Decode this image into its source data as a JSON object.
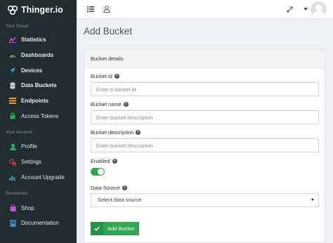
{
  "sidebar": {
    "brand": "Thinger.io",
    "sections": [
      {
        "label": "Your Cloud",
        "items": [
          {
            "label": "Statistics",
            "icon": "chart-icon",
            "color": "#c64fd6"
          },
          {
            "label": "Dashboards",
            "icon": "dashboard-icon",
            "color": "#4caf50"
          },
          {
            "label": "Devices",
            "icon": "rocket-icon",
            "color": "#3c8dbc"
          },
          {
            "label": "Data Buckets",
            "icon": "database-icon",
            "color": "#c7d1d6"
          },
          {
            "label": "Endpoints",
            "icon": "list-icon",
            "color": "#f39c12"
          },
          {
            "label": "Access Tokens",
            "icon": "lock-icon",
            "color": "#27ae60"
          }
        ]
      },
      {
        "label": "Your Account",
        "items": [
          {
            "label": "Profile",
            "icon": "user-icon",
            "color": "#27ae60"
          },
          {
            "label": "Settings",
            "icon": "cogs-icon",
            "color": "#dd4b39"
          },
          {
            "label": "Account Upgrade",
            "icon": "bar-chart-icon",
            "color": "#3c8dbc"
          }
        ]
      },
      {
        "label": "Resources",
        "items": [
          {
            "label": "Shop",
            "icon": "shopping-bag-icon",
            "color": "#c64fd6"
          },
          {
            "label": "Documentation",
            "icon": "book-icon",
            "color": "#3c8dbc"
          }
        ]
      }
    ]
  },
  "page": {
    "title": "Add Bucket"
  },
  "form": {
    "header": "Bucket details",
    "bucket_id": {
      "label": "Bucket id",
      "placeholder": "Enter a bucket id"
    },
    "bucket_name": {
      "label": "Bucket name",
      "placeholder": "Enter bucket description"
    },
    "bucket_description": {
      "label": "Bucket description",
      "placeholder": "Enter bucket description"
    },
    "enabled": {
      "label": "Enabled",
      "value": true
    },
    "data_source": {
      "label": "Data Source",
      "selected": "Select data source"
    },
    "submit_label": "Add Bucket"
  },
  "colors": {
    "accent_green": "#2fa84f",
    "sidebar_bg": "#222d32"
  }
}
